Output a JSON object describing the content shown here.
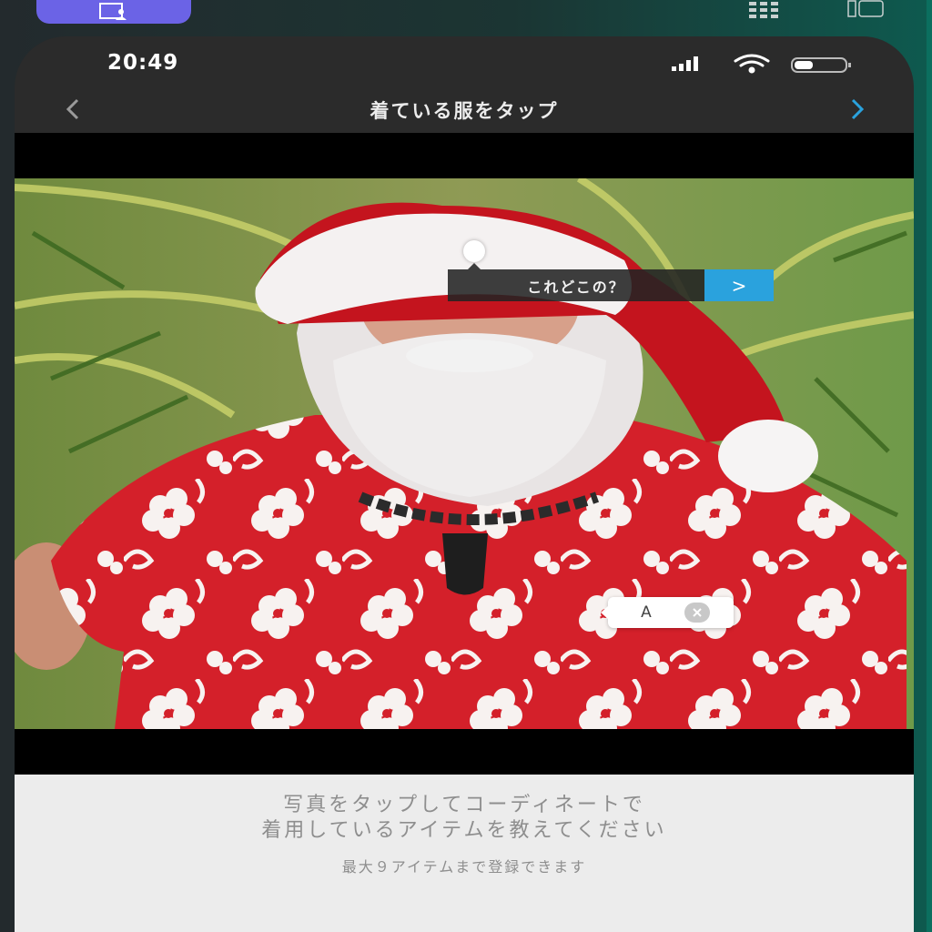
{
  "status_bar": {
    "time": "20:49"
  },
  "nav": {
    "title": "着ている服をタップ"
  },
  "tooltip": {
    "text": "これどこの？",
    "go": ">"
  },
  "tag": {
    "label": "A"
  },
  "instructions": {
    "line1": "写真をタップしてコーディネートで",
    "line2": "着用しているアイテムを教えてください",
    "sub": "最大９アイテムまで登録できます"
  },
  "colors": {
    "host_pill": "#6b63e6",
    "nav_next_accent": "#2aa2dd",
    "tooltip_go": "#2aa2dd",
    "shirt_red": "#d4202a"
  },
  "icons": [
    "host-user-icon",
    "grid-icon",
    "window-layout-icon",
    "signal-icon",
    "wifi-icon",
    "battery-icon",
    "chevron-left-icon",
    "chevron-right-icon",
    "close-icon"
  ]
}
